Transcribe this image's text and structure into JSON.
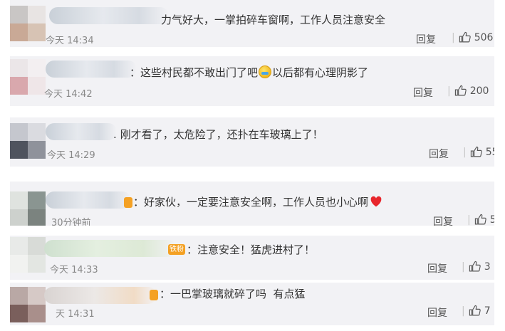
{
  "comments": [
    {
      "text_prefix": "",
      "text": "力气好大，一掌拍碎车窗啊，工作人员注意安全",
      "time": "今天 14:34",
      "reply": "回复",
      "likes": "506"
    },
    {
      "text_prefix": "：",
      "text": "这些村民都不敢出门了吧",
      "text_after_emoji": "以后都有心理阴影了",
      "emoji": "cry-icon",
      "time": "今天 14:42",
      "reply": "回复",
      "likes": "200"
    },
    {
      "text_prefix": "：",
      "text": "刚才看了，太危险了，还扑在车玻璃上了！",
      "time": "今天 14:29",
      "reply": "回复",
      "likes": "55"
    },
    {
      "text_prefix": "：",
      "text": "好家伙，一定要注意安全啊，工作人员也小心啊",
      "emoji": "red-heart-icon",
      "time": "30分钟前",
      "reply": "回复",
      "likes": "5"
    },
    {
      "badge": "铁粉",
      "text_prefix": "：",
      "text": "注意安全！猛虎进村了！",
      "time": "今天 14:33",
      "reply": "回复",
      "likes": "3"
    },
    {
      "text_prefix": "：",
      "text": "一巴掌玻璃就碎了吗  有点猛",
      "time": "天 14:31",
      "reply": "回复",
      "likes": "7"
    }
  ],
  "colors": {
    "card_bg": "#f2f2f5",
    "text": "#333333",
    "meta": "#888888",
    "badge": "#f4a124",
    "heart": "#e8262c"
  }
}
